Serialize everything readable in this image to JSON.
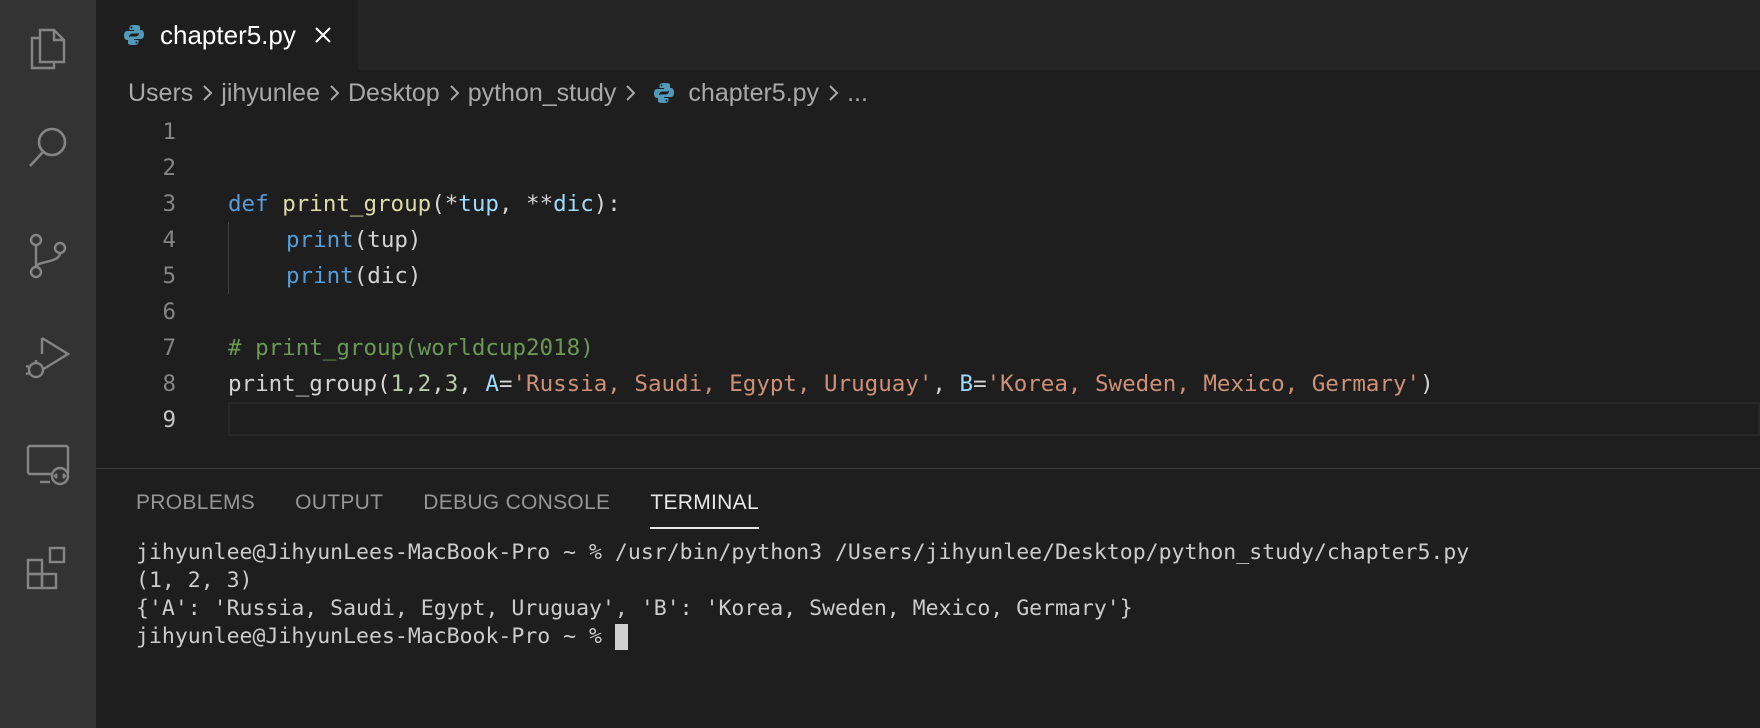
{
  "tab": {
    "label": "chapter5.py"
  },
  "breadcrumb": {
    "items": [
      "Users",
      "jihyunlee",
      "Desktop",
      "python_study"
    ],
    "file": "chapter5.py",
    "more": "..."
  },
  "editor": {
    "line_numbers": [
      "1",
      "2",
      "3",
      "4",
      "5",
      "6",
      "7",
      "8",
      "9"
    ],
    "line3": {
      "kw": "def",
      "fn": "print_group",
      "open": "(*",
      "p1": "tup",
      "comma": ", **",
      "p2": "dic",
      "close": "):"
    },
    "line4": {
      "fn": "print",
      "rest": "(tup)"
    },
    "line5": {
      "fn": "print",
      "rest": "(dic)"
    },
    "line7": {
      "comment": "# print_group(worldcup2018)"
    },
    "line8": {
      "fn": "print_group",
      "open": "(",
      "n1": "1",
      "c1": ",",
      "n2": "2",
      "c2": ",",
      "n3": "3",
      "c3": ", ",
      "kA": "A",
      "eq1": "=",
      "sA": "'Russia, Saudi, Egypt, Uruguay'",
      "c4": ", ",
      "kB": "B",
      "eq2": "=",
      "sB": "'Korea, Sweden, Mexico, Germary'",
      "close": ")"
    }
  },
  "panel": {
    "tabs": [
      "PROBLEMS",
      "OUTPUT",
      "DEBUG CONSOLE",
      "TERMINAL"
    ],
    "active_tab": "TERMINAL"
  },
  "terminal": {
    "lines": [
      "jihyunlee@JihyunLees-MacBook-Pro ~ % /usr/bin/python3 /Users/jihyunlee/Desktop/python_study/chapter5.py",
      "(1, 2, 3)",
      "{'A': 'Russia, Saudi, Egypt, Uruguay', 'B': 'Korea, Sweden, Mexico, Germary'}"
    ],
    "prompt": "jihyunlee@JihyunLees-MacBook-Pro ~ % "
  },
  "colors": {
    "activity_bar": "#333333",
    "editor_bg": "#1e1e1e",
    "keyword": "#569cd6",
    "function": "#dcdcaa",
    "parameter": "#9cdcfe",
    "string": "#ce9178",
    "number": "#b5cea8",
    "comment": "#6a9955"
  },
  "icons": [
    "explorer-icon",
    "search-icon",
    "source-control-icon",
    "run-debug-icon",
    "remote-explorer-icon",
    "extensions-icon",
    "python-file-icon",
    "close-icon",
    "chevron-right-icon"
  ]
}
